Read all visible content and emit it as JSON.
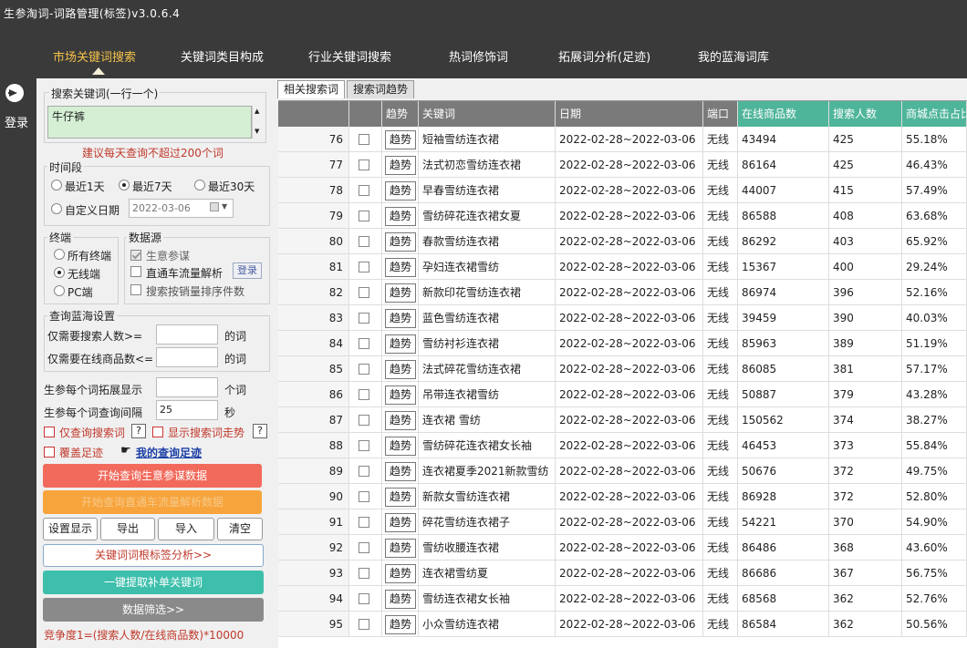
{
  "window": {
    "title": "生参淘词-词路管理(标签)v3.0.6.4"
  },
  "nav": {
    "tabs": [
      {
        "label": "市场关键词搜索",
        "active": true
      },
      {
        "label": "关键词类目构成",
        "active": false
      },
      {
        "label": "行业关键词搜索",
        "active": false
      },
      {
        "label": "热词修饰词",
        "active": false
      },
      {
        "label": "拓展词分析(足迹)",
        "active": false
      },
      {
        "label": "我的蓝海词库",
        "active": false
      }
    ],
    "login_label": "登录"
  },
  "search": {
    "legend": "搜索关键词(一行一个)",
    "value": "牛仔裤",
    "hint": "建议每天查询不超过200个词"
  },
  "time_range": {
    "legend": "时间段",
    "options": [
      "最近1天",
      "最近7天",
      "最近30天"
    ],
    "custom_label": "自定义日期",
    "custom_date": "2022-03-06",
    "selected": "最近7天"
  },
  "terminal": {
    "legend": "终端",
    "options": [
      "所有终端",
      "无线端",
      "PC端"
    ],
    "selected": "无线端"
  },
  "data_source": {
    "legend": "数据源",
    "options": [
      "生意参谋",
      "直通车流量解析",
      "搜索按销量排序件数"
    ],
    "login_button": "登录"
  },
  "bluesea": {
    "legend": "查询蓝海设置",
    "search_people_label": "仅需要搜索人数>=",
    "search_people_unit": "的词",
    "online_goods_label": "仅需要在线商品数<=",
    "online_goods_unit": "的词"
  },
  "expand": {
    "per_word_label": "生参每个词拓展显示",
    "per_word_unit": "个词",
    "interval_label": "生参每个词查询间隔",
    "interval_value": "25",
    "interval_unit": "秒"
  },
  "options": {
    "only_search_words": "仅查询搜索词",
    "show_trend": "显示搜索词走势",
    "qmark": "?",
    "cover_footprint": "覆盖足迹",
    "my_footprint": "我的查询足迹"
  },
  "buttons": {
    "start_sycm": "开始查询生意参谋数据",
    "start_ztc": "开始查询直通车流量解析数据",
    "settings": "设置显示",
    "export": "导出",
    "import": "导入",
    "clear": "清空",
    "root_analysis": "关键词词根标签分析>>",
    "extract": "一键提取补单关键词",
    "filter": "数据筛选>>"
  },
  "formula": "竞争度1=(搜索人数/在线商品数)*10000",
  "colors": {
    "nav_active": "#f4c24a",
    "btn_red": "#f26a5c",
    "btn_orange": "#f8a43c",
    "btn_teal": "#3dbfab",
    "btn_gray": "#8a8a8a",
    "header_gray": "#7a7a7a",
    "header_green": "#4fb59a",
    "hint_red": "#c0392b"
  },
  "result_tabs": [
    "相关搜索词",
    "搜索词趋势"
  ],
  "table": {
    "columns": [
      "",
      "",
      "趋势",
      "关键词",
      "日期",
      "端口",
      "在线商品数",
      "搜索人数",
      "商城点击占比"
    ],
    "trend_label": "趋势",
    "rows": [
      {
        "no": "76",
        "keyword": "短袖雪纺连衣裙",
        "date": "2022-02-28~2022-03-06",
        "port": "无线",
        "goods": "43494",
        "people": "425",
        "ratio": "55.18%"
      },
      {
        "no": "77",
        "keyword": "法式初恋雪纺连衣裙",
        "date": "2022-02-28~2022-03-06",
        "port": "无线",
        "goods": "86164",
        "people": "425",
        "ratio": "46.43%"
      },
      {
        "no": "78",
        "keyword": "早春雪纺连衣裙",
        "date": "2022-02-28~2022-03-06",
        "port": "无线",
        "goods": "44007",
        "people": "415",
        "ratio": "57.49%"
      },
      {
        "no": "79",
        "keyword": "雪纺碎花连衣裙女夏",
        "date": "2022-02-28~2022-03-06",
        "port": "无线",
        "goods": "86588",
        "people": "408",
        "ratio": "63.68%"
      },
      {
        "no": "80",
        "keyword": "春款雪纺连衣裙",
        "date": "2022-02-28~2022-03-06",
        "port": "无线",
        "goods": "86292",
        "people": "403",
        "ratio": "65.92%"
      },
      {
        "no": "81",
        "keyword": "孕妇连衣裙雪纺",
        "date": "2022-02-28~2022-03-06",
        "port": "无线",
        "goods": "15367",
        "people": "400",
        "ratio": "29.24%"
      },
      {
        "no": "82",
        "keyword": "新款印花雪纺连衣裙",
        "date": "2022-02-28~2022-03-06",
        "port": "无线",
        "goods": "86974",
        "people": "396",
        "ratio": "52.16%"
      },
      {
        "no": "83",
        "keyword": "蓝色雪纺连衣裙",
        "date": "2022-02-28~2022-03-06",
        "port": "无线",
        "goods": "39459",
        "people": "390",
        "ratio": "40.03%"
      },
      {
        "no": "84",
        "keyword": "雪纺衬衫连衣裙",
        "date": "2022-02-28~2022-03-06",
        "port": "无线",
        "goods": "85963",
        "people": "389",
        "ratio": "51.19%"
      },
      {
        "no": "85",
        "keyword": "法式碎花雪纺连衣裙",
        "date": "2022-02-28~2022-03-06",
        "port": "无线",
        "goods": "86085",
        "people": "381",
        "ratio": "57.17%"
      },
      {
        "no": "86",
        "keyword": "吊带连衣裙雪纺",
        "date": "2022-02-28~2022-03-06",
        "port": "无线",
        "goods": "50887",
        "people": "379",
        "ratio": "43.28%"
      },
      {
        "no": "87",
        "keyword": "连衣裙 雪纺",
        "date": "2022-02-28~2022-03-06",
        "port": "无线",
        "goods": "150562",
        "people": "374",
        "ratio": "38.27%"
      },
      {
        "no": "88",
        "keyword": "雪纺碎花连衣裙女长袖",
        "date": "2022-02-28~2022-03-06",
        "port": "无线",
        "goods": "46453",
        "people": "373",
        "ratio": "55.84%"
      },
      {
        "no": "89",
        "keyword": "连衣裙夏季2021新款雪纺",
        "date": "2022-02-28~2022-03-06",
        "port": "无线",
        "goods": "50676",
        "people": "372",
        "ratio": "49.75%"
      },
      {
        "no": "90",
        "keyword": "新款女雪纺连衣裙",
        "date": "2022-02-28~2022-03-06",
        "port": "无线",
        "goods": "86928",
        "people": "372",
        "ratio": "52.80%"
      },
      {
        "no": "91",
        "keyword": "碎花雪纺连衣裙子",
        "date": "2022-02-28~2022-03-06",
        "port": "无线",
        "goods": "54221",
        "people": "370",
        "ratio": "54.90%"
      },
      {
        "no": "92",
        "keyword": "雪纺收腰连衣裙",
        "date": "2022-02-28~2022-03-06",
        "port": "无线",
        "goods": "86486",
        "people": "368",
        "ratio": "43.60%"
      },
      {
        "no": "93",
        "keyword": "连衣裙雪纺夏",
        "date": "2022-02-28~2022-03-06",
        "port": "无线",
        "goods": "86686",
        "people": "367",
        "ratio": "56.75%"
      },
      {
        "no": "94",
        "keyword": "雪纺连衣裙女长袖",
        "date": "2022-02-28~2022-03-06",
        "port": "无线",
        "goods": "68568",
        "people": "362",
        "ratio": "52.76%"
      },
      {
        "no": "95",
        "keyword": "小众雪纺连衣裙",
        "date": "2022-02-28~2022-03-06",
        "port": "无线",
        "goods": "86584",
        "people": "362",
        "ratio": "50.56%"
      }
    ]
  }
}
